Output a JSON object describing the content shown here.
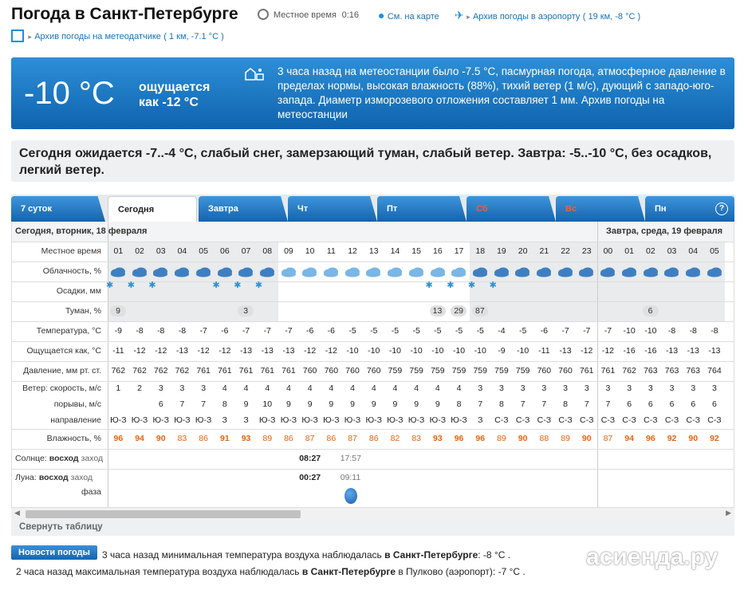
{
  "header": {
    "title": "Погода в Санкт-Петербурге",
    "local_time_label": "Местное время",
    "local_time": "0:16",
    "map_link": "См. на карте",
    "airport_link": "Архив погоды в аэропорту",
    "airport_info": "( 19 км, -8 °С )",
    "station_link": "Архив погоды на метеодатчике",
    "station_info": "( 1 км, -7.1 °С )"
  },
  "current": {
    "temp": "-10 °С",
    "feels": "ощущается как -12 °С",
    "desc": "3 часа назад на метеостанции было -7.5 °С, пасмурная погода, атмосферное давление в пределах нормы, высокая влажность (88%), тихий ветер (1 м/с), дующий с западо-юго-запада. Диаметр изморозевого отложения составляет 1 мм. Архив погоды на метеостанции"
  },
  "summary": "Сегодня ожидается -7..-4 °С, слабый снег, замерзающий туман, слабый ветер. Завтра: -5..-10 °С, без осадков, легкий ветер.",
  "tabs": [
    {
      "label": "7 суток"
    },
    {
      "label": "Сегодня"
    },
    {
      "label": "Завтра"
    },
    {
      "label": "Чт"
    },
    {
      "label": "Пт"
    },
    {
      "label": "Сб"
    },
    {
      "label": "Вс"
    },
    {
      "label": "Пн"
    }
  ],
  "help": "?",
  "dates": {
    "today": "Сегодня, вторник, 18 февраля",
    "tomorrow": "Завтра, среда, 19 февраля"
  },
  "labels": {
    "time": "Местное время",
    "cloud": "Облачность, %",
    "precip": "Осадки, мм",
    "fog": "Туман, %",
    "temp": "Температура, °С",
    "feels": "Ощущается как, °С",
    "pressure": "Давление, мм рт. ст.",
    "wind_speed": "Ветер: скорость, м/с",
    "gusts": "порывы, м/с",
    "direction": "направление",
    "humidity": "Влажность, %",
    "sun_a": "Солнце:",
    "sun_b": "восход",
    "sun_c": "заход",
    "moon_a": "Луна:",
    "moon_b": "восход",
    "moon_c": "заход",
    "phase": "фаза"
  },
  "hours": [
    "01",
    "02",
    "03",
    "04",
    "05",
    "06",
    "07",
    "08",
    "09",
    "10",
    "11",
    "12",
    "13",
    "14",
    "15",
    "16",
    "17",
    "18",
    "19",
    "20",
    "21",
    "22",
    "23",
    "00",
    "01",
    "02",
    "03",
    "04",
    "05"
  ],
  "snow": [
    1,
    1,
    1,
    0,
    0,
    1,
    1,
    1,
    0,
    0,
    0,
    0,
    0,
    0,
    0,
    1,
    1,
    1,
    1,
    0,
    0,
    0,
    0,
    0,
    0,
    0,
    0,
    0,
    0
  ],
  "fog": [
    "9",
    "",
    "",
    "",
    "",
    "",
    "3",
    "",
    "",
    "",
    "",
    "",
    "",
    "",
    "",
    "13",
    "29",
    "87",
    "",
    "",
    "",
    "",
    "",
    "",
    "",
    "6",
    "",
    "",
    ""
  ],
  "temp": [
    "-9",
    "-8",
    "-8",
    "-8",
    "-7",
    "-6",
    "-7",
    "-7",
    "-7",
    "-6",
    "-6",
    "-5",
    "-5",
    "-5",
    "-5",
    "-5",
    "-5",
    "-5",
    "-4",
    "-5",
    "-6",
    "-7",
    "-7",
    "-7",
    "-10",
    "-10",
    "-8",
    "-8",
    "-8"
  ],
  "feels": [
    "-11",
    "-12",
    "-12",
    "-13",
    "-12",
    "-12",
    "-13",
    "-13",
    "-13",
    "-12",
    "-12",
    "-10",
    "-10",
    "-10",
    "-10",
    "-10",
    "-10",
    "-10",
    "-9",
    "-10",
    "-11",
    "-13",
    "-12",
    "-12",
    "-16",
    "-16",
    "-13",
    "-13",
    "-13"
  ],
  "pressure": [
    "762",
    "762",
    "762",
    "762",
    "761",
    "761",
    "761",
    "761",
    "761",
    "760",
    "760",
    "760",
    "760",
    "759",
    "759",
    "759",
    "759",
    "759",
    "759",
    "759",
    "760",
    "760",
    "761",
    "761",
    "762",
    "763",
    "763",
    "763",
    "764"
  ],
  "wind": [
    "1",
    "2",
    "3",
    "3",
    "3",
    "4",
    "4",
    "4",
    "4",
    "4",
    "4",
    "4",
    "4",
    "4",
    "4",
    "4",
    "4",
    "3",
    "3",
    "3",
    "3",
    "3",
    "3",
    "3",
    "3",
    "3",
    "3",
    "3",
    "3"
  ],
  "gusts": [
    "",
    "",
    "6",
    "7",
    "7",
    "8",
    "9",
    "10",
    "9",
    "9",
    "9",
    "9",
    "9",
    "9",
    "9",
    "9",
    "8",
    "7",
    "8",
    "7",
    "7",
    "8",
    "7",
    "7",
    "6",
    "6",
    "6",
    "6",
    "6"
  ],
  "dir": [
    "Ю-З",
    "Ю-З",
    "Ю-З",
    "Ю-З",
    "Ю-З",
    "З",
    "З",
    "Ю-З",
    "Ю-З",
    "Ю-З",
    "Ю-З",
    "Ю-З",
    "Ю-З",
    "Ю-З",
    "Ю-З",
    "Ю-З",
    "Ю-З",
    "З",
    "С-З",
    "С-З",
    "С-З",
    "С-З",
    "С-З",
    "С-З",
    "С-З",
    "С-З",
    "С-З",
    "С-З",
    "С-З"
  ],
  "humidity": [
    "96",
    "94",
    "90",
    "83",
    "86",
    "91",
    "93",
    "89",
    "86",
    "87",
    "86",
    "87",
    "86",
    "82",
    "83",
    "93",
    "96",
    "96",
    "89",
    "90",
    "88",
    "89",
    "90",
    "87",
    "94",
    "96",
    "92",
    "90",
    "92"
  ],
  "sun": {
    "rise": "08:27",
    "set": "17:57"
  },
  "moon": {
    "rise": "00:27",
    "set": "09:11"
  },
  "collapse": "Свернуть таблицу",
  "news": {
    "badge": "Новости погоды",
    "line1a": "3 часа назад минимальная температура воздуха наблюдалась ",
    "line1b": "в Санкт-Петербурге",
    "line1c": ": -8 °С .",
    "line2a": "2 часа назад максимальная температура воздуха наблюдалась ",
    "line2b": "в Санкт-Петербурге",
    "line2c": " в Пулково (аэропорт): -7 °С ."
  },
  "watermark": "асиенда.ру"
}
